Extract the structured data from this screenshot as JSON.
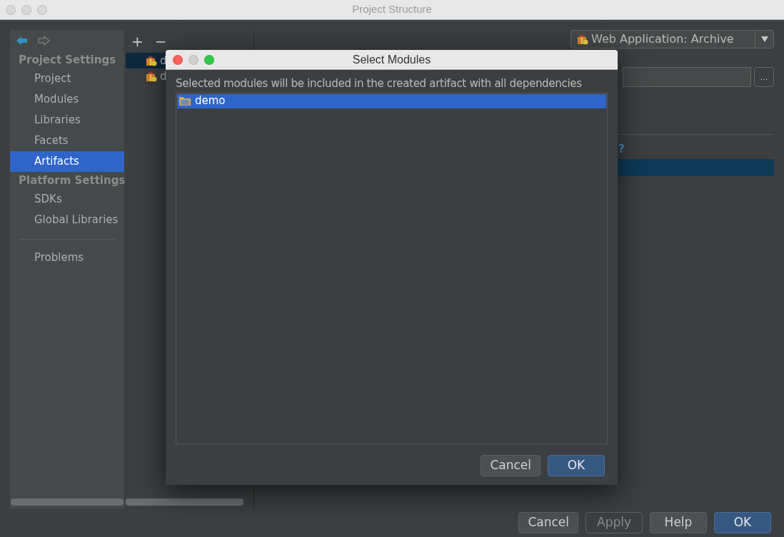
{
  "window": {
    "title": "Project Structure"
  },
  "sidebar": {
    "sections": [
      {
        "title": "Project Settings",
        "items": [
          {
            "label": "Project",
            "selected": false
          },
          {
            "label": "Modules",
            "selected": false
          },
          {
            "label": "Libraries",
            "selected": false
          },
          {
            "label": "Facets",
            "selected": false
          },
          {
            "label": "Artifacts",
            "selected": true
          }
        ]
      },
      {
        "title": "Platform Settings",
        "items": [
          {
            "label": "SDKs",
            "selected": false
          },
          {
            "label": "Global Libraries",
            "selected": false
          }
        ]
      }
    ],
    "extra_items": [
      {
        "label": "Problems",
        "selected": false
      }
    ]
  },
  "artifacts": {
    "toolbar": [
      "+",
      "−"
    ],
    "items": [
      {
        "label": "d",
        "selected": true
      },
      {
        "label": "d",
        "selected": false
      }
    ]
  },
  "detail": {
    "type_value": "Web Application: Archive",
    "browse": "...",
    "help": "?"
  },
  "buttons": [
    {
      "label": "Cancel",
      "kind": "normal",
      "disabled": false
    },
    {
      "label": "Apply",
      "kind": "normal",
      "disabled": true
    },
    {
      "label": "Help",
      "kind": "normal",
      "disabled": false
    },
    {
      "label": "OK",
      "kind": "default",
      "disabled": false
    }
  ],
  "dialog": {
    "title": "Select Modules",
    "message": "Selected modules will be included in the created artifact with all dependencies",
    "modules": [
      {
        "label": "demo",
        "selected": true
      }
    ],
    "buttons": [
      {
        "label": "Cancel",
        "kind": "normal"
      },
      {
        "label": "OK",
        "kind": "default"
      }
    ]
  }
}
